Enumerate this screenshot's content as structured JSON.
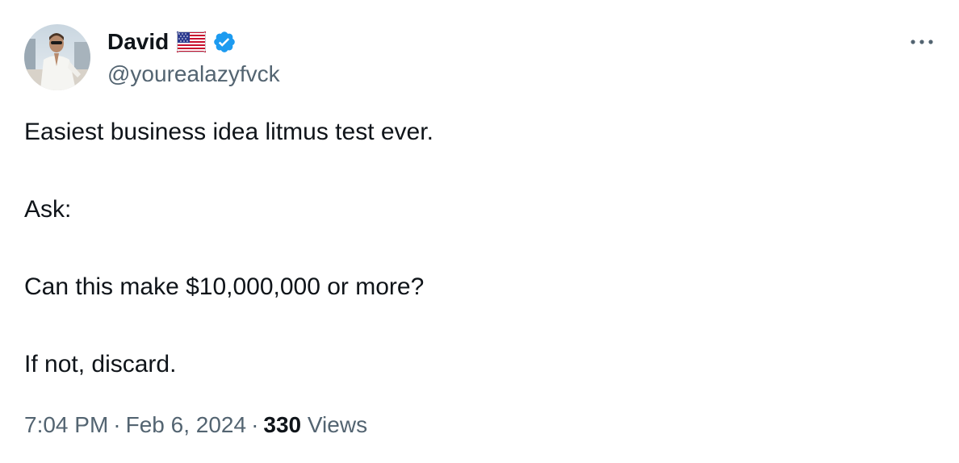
{
  "author": {
    "display_name": "David",
    "handle": "@yourealazyfvck",
    "flag_icon": "us-flag-icon",
    "verified_icon": "verified-badge-icon"
  },
  "tweet": {
    "lines": [
      "Easiest business idea litmus test ever.",
      "Ask:",
      "Can this make $10,000,000 or more?",
      "If not, discard."
    ]
  },
  "meta": {
    "time": "7:04 PM",
    "date": "Feb 6, 2024",
    "separator": "·",
    "views_count": "330",
    "views_label": "Views"
  },
  "colors": {
    "text_primary": "#0f1419",
    "text_secondary": "#536471",
    "verified_blue": "#1d9bf0"
  }
}
